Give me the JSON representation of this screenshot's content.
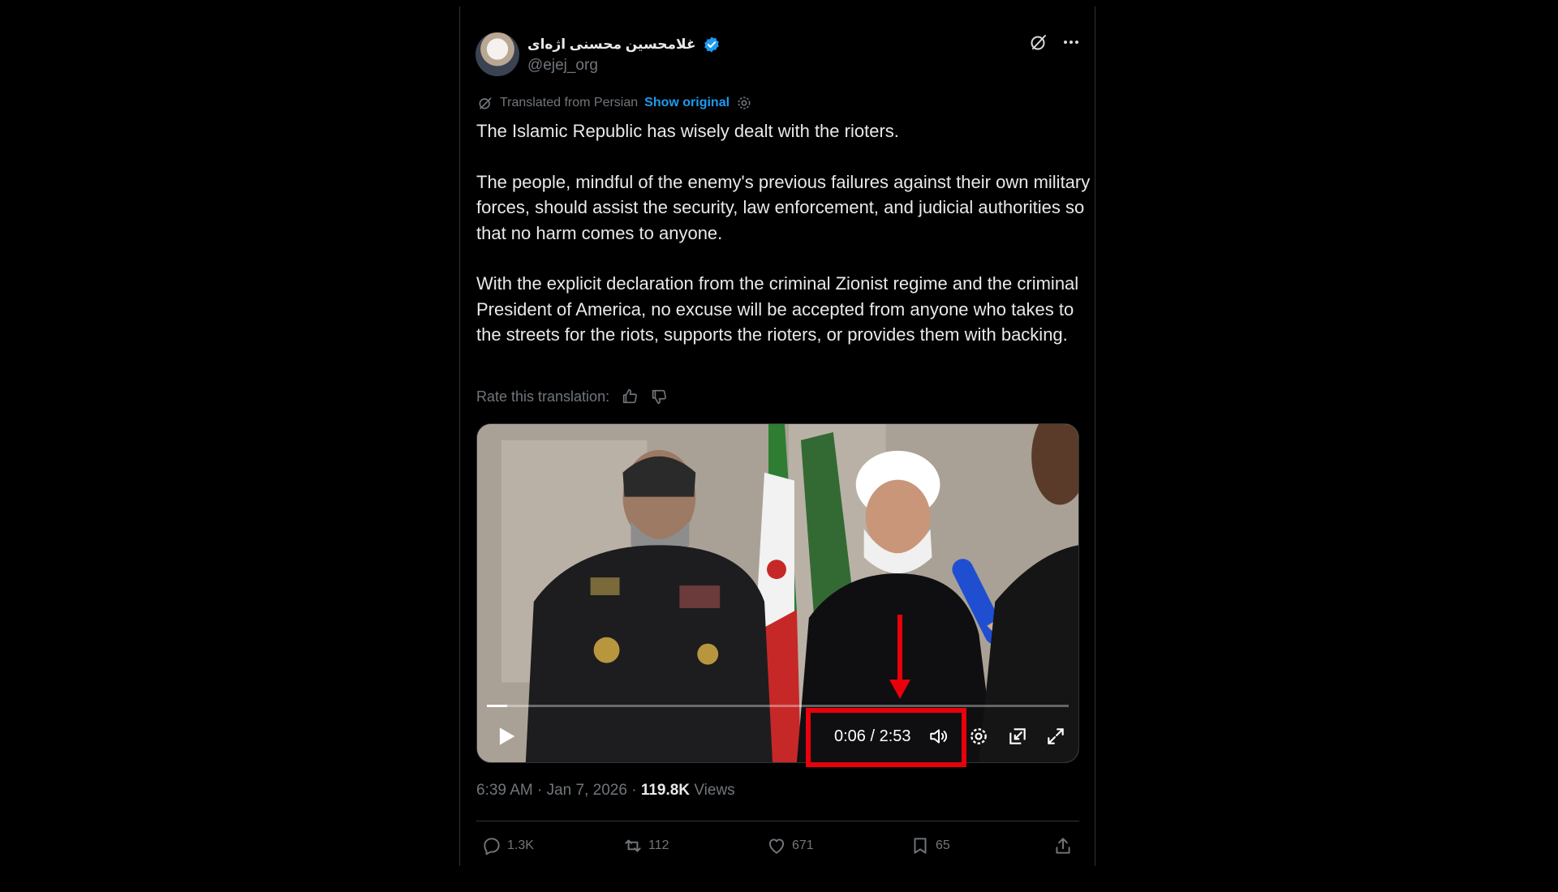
{
  "author": {
    "display_name": "غلامحسین محسنی اژه‌ای",
    "handle": "@ejej_org",
    "verified": true
  },
  "translation": {
    "label": "Translated from Persian",
    "show_original": "Show original"
  },
  "tweet": {
    "paragraphs": [
      "The Islamic Republic has wisely dealt with the rioters.",
      "The people, mindful of the enemy's previous failures against their own military forces, should assist the security, law enforcement, and judicial authorities so that no harm comes to anyone.",
      "With the explicit declaration from the criminal Zionist regime and the criminal President of America, no excuse will be accepted from anyone who takes to the streets for the riots, supports the rioters, or provides them with backing."
    ]
  },
  "rate": {
    "label": "Rate this translation:"
  },
  "video": {
    "time": "0:06 / 2:53",
    "progress": 0.035
  },
  "meta": {
    "time": "6:39 AM",
    "date": "Jan 7, 2026",
    "views_count": "119.8K",
    "views_label": "Views"
  },
  "actions": {
    "replies": "1.3K",
    "reposts": "112",
    "likes": "671",
    "bookmarks": "65"
  },
  "colors": {
    "accent": "#1d9bf0",
    "highlight": "#e8000b",
    "background": "#000000"
  }
}
